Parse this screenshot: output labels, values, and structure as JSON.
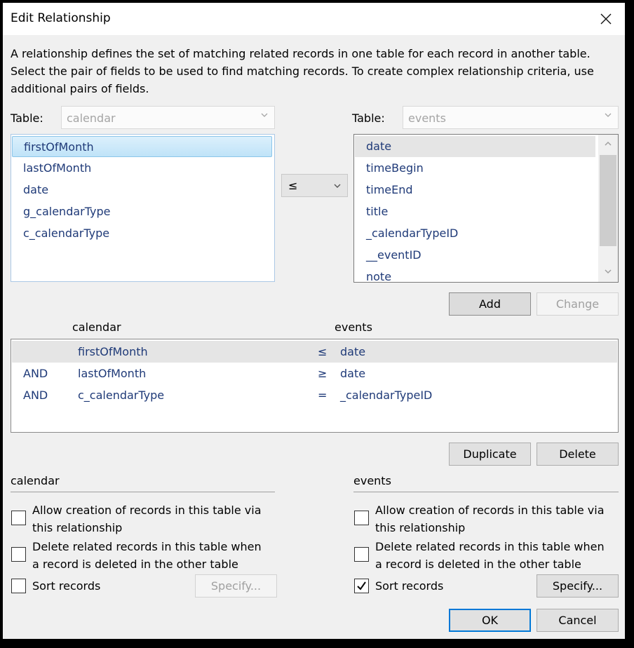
{
  "window": {
    "title": "Edit Relationship",
    "close_icon": "close-x-icon"
  },
  "description": "A relationship defines the set of matching related records in one table for each record in another table. Select the pair of fields to be used to find matching records. To create complex relationship criteria, use additional pairs of fields.",
  "left_table": {
    "label": "Table:",
    "selected": "calendar",
    "fields": [
      "firstOfMonth",
      "lastOfMonth",
      "date",
      "g_calendarType",
      "c_calendarType"
    ],
    "selected_index": 0
  },
  "operator": {
    "selected": "≤"
  },
  "right_table": {
    "label": "Table:",
    "selected": "events",
    "fields": [
      "date",
      "timeBegin",
      "timeEnd",
      "title",
      "_calendarTypeID",
      "__eventID",
      "note"
    ],
    "selected_index": 0
  },
  "buttons": {
    "add": "Add",
    "change": "Change",
    "duplicate": "Duplicate",
    "delete": "Delete",
    "ok": "OK",
    "cancel": "Cancel",
    "specify_left": "Specify...",
    "specify_right": "Specify..."
  },
  "criteria": {
    "header_left": "calendar",
    "header_right": "events",
    "rows": [
      {
        "conj": "",
        "left": "firstOfMonth",
        "op": "≤",
        "right": "date",
        "selected": true
      },
      {
        "conj": "AND",
        "left": "lastOfMonth",
        "op": "≥",
        "right": "date",
        "selected": false
      },
      {
        "conj": "AND",
        "left": "c_calendarType",
        "op": "=",
        "right": "_calendarTypeID",
        "selected": false
      }
    ]
  },
  "options_left": {
    "title": "calendar",
    "allow_creation": {
      "line1": "Allow creation of records in this table via",
      "line2": "this relationship",
      "checked": false
    },
    "delete_related": {
      "line1": "Delete related records in this table when",
      "line2": "a record is deleted in the other table",
      "checked": false
    },
    "sort_records": {
      "label": "Sort records",
      "checked": false
    }
  },
  "options_right": {
    "title": "events",
    "allow_creation": {
      "line1": "Allow creation of records in this table via",
      "line2": "this relationship",
      "checked": false
    },
    "delete_related": {
      "line1": "Delete related records in this table when",
      "line2": "a record is deleted in the other table",
      "checked": false
    },
    "sort_records": {
      "label": "Sort records",
      "checked": true
    }
  },
  "colors": {
    "field_text": "#1f3a78",
    "selection_blue": "#bfe3f8",
    "default_button_border": "#0078d7"
  }
}
